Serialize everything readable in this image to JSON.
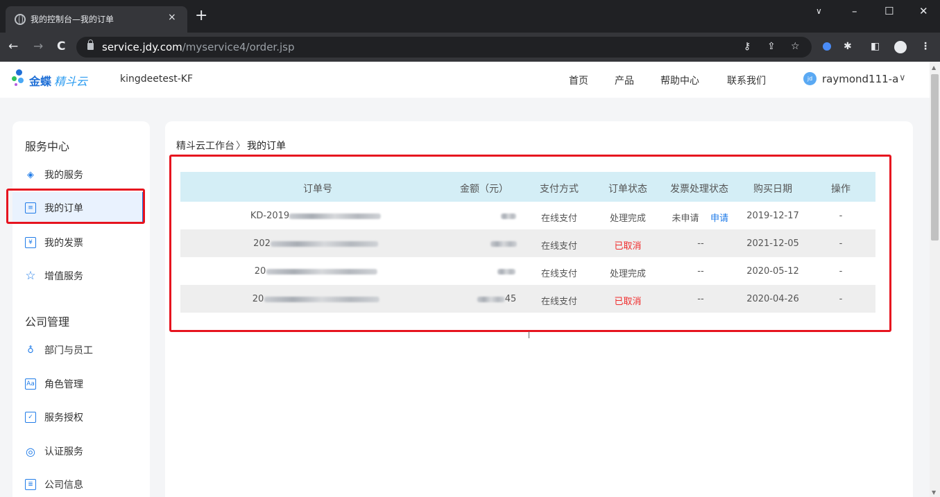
{
  "browser": {
    "tab_title": "我的控制台—我的订单",
    "tab_close": "×",
    "new_tab": "+",
    "url_host": "service.jdy.com",
    "url_path": "/myservice4/order.jsp",
    "window_controls": {
      "chevron": "∨",
      "minimize": "–",
      "maximize": "☐",
      "close": "✕"
    },
    "nav": {
      "back": "←",
      "forward": "→",
      "reload": "C"
    },
    "icons": [
      "key-icon",
      "share-icon",
      "star-icon",
      "extension-icon",
      "puzzle-icon",
      "sidepanel-icon",
      "profile-icon",
      "menu-icon"
    ]
  },
  "site": {
    "brand_main": "金蝶",
    "brand_sub": "精斗云",
    "tenant": "kingdeetest-KF",
    "nav": [
      "首页",
      "产品",
      "帮助中心",
      "联系我们"
    ],
    "user_avatar": "jd",
    "user_name": "raymond111-a",
    "caret": "∨",
    "accent": "#1f7be8",
    "highlight_red": "#e6141f"
  },
  "sidebar": {
    "section1": "服务中心",
    "items1": [
      {
        "label": "我的服务",
        "icon": "layers-icon"
      },
      {
        "label": "我的订单",
        "icon": "order-icon",
        "active": true
      },
      {
        "label": "我的发票",
        "icon": "invoice-icon"
      },
      {
        "label": "增值服务",
        "icon": "star-icon"
      }
    ],
    "section2": "公司管理",
    "items2": [
      {
        "label": "部门与员工",
        "icon": "people-icon"
      },
      {
        "label": "角色管理",
        "icon": "role-icon"
      },
      {
        "label": "服务授权",
        "icon": "authorize-icon"
      },
      {
        "label": "认证服务",
        "icon": "certify-icon"
      },
      {
        "label": "公司信息",
        "icon": "company-icon"
      }
    ]
  },
  "breadcrumb": {
    "root": "精斗云工作台",
    "sep": "〉",
    "current": "我的订单"
  },
  "table": {
    "headers": [
      "订单号",
      "金额（元）",
      "支付方式",
      "订单状态",
      "发票处理状态",
      "购买日期",
      "操作"
    ],
    "rows": [
      {
        "order_prefix": "KD-2019",
        "amount_suffix": "",
        "pay": "在线支付",
        "status": "处理完成",
        "invoice": "未申请",
        "invoice_action": "申请",
        "date": "2019-12-17",
        "op": "-"
      },
      {
        "order_prefix": "202",
        "amount_suffix": "",
        "pay": "在线支付",
        "status": "已取消",
        "invoice": "--",
        "invoice_action": "",
        "date": "2021-12-05",
        "op": "-"
      },
      {
        "order_prefix": "20",
        "amount_suffix": "",
        "pay": "在线支付",
        "status": "处理完成",
        "invoice": "--",
        "invoice_action": "",
        "date": "2020-05-12",
        "op": "-"
      },
      {
        "order_prefix": "20",
        "amount_suffix": "45",
        "pay": "在线支付",
        "status": "已取消",
        "invoice": "--",
        "invoice_action": "",
        "date": "2020-04-26",
        "op": "-"
      }
    ]
  }
}
